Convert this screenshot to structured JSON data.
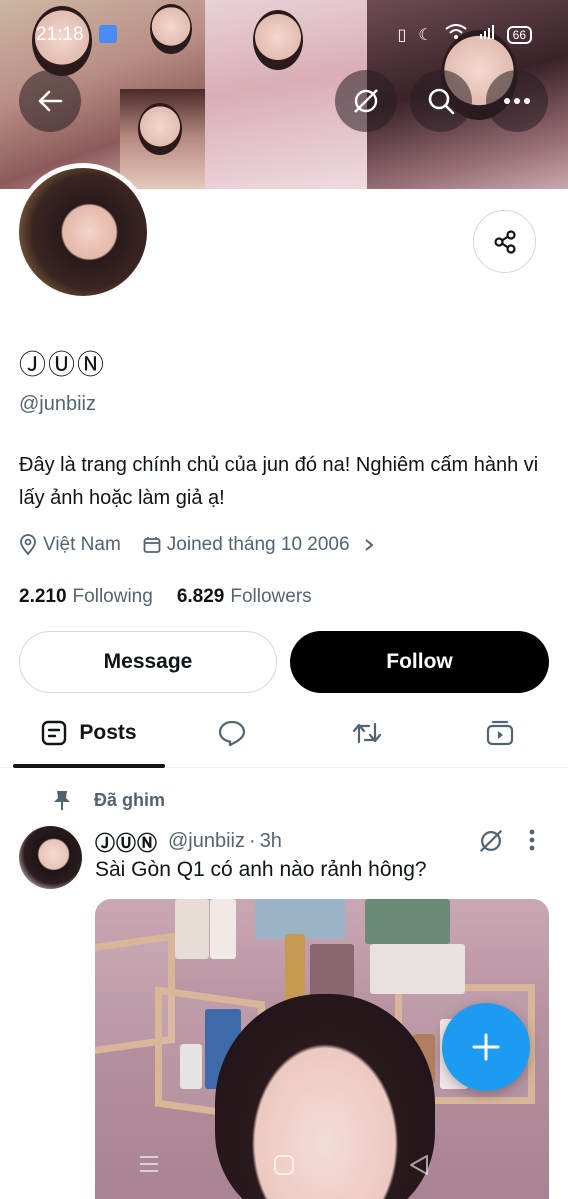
{
  "status_bar": {
    "time": "21:18",
    "battery": "66"
  },
  "profile": {
    "display_name": "ⒿⓊⓃ",
    "handle": "@junbiiz",
    "bio": "Đây là trang chính chủ của jun đó na! Nghiêm cấm hành vi lấy ảnh hoặc làm giả ạ!",
    "location": "Việt Nam",
    "joined": "Joined tháng 10 2006",
    "following_count": "2.210",
    "following_label": "Following",
    "followers_count": "6.829",
    "followers_label": "Followers"
  },
  "actions": {
    "message_label": "Message",
    "follow_label": "Follow"
  },
  "tabs": {
    "posts_label": "Posts"
  },
  "pinned_post": {
    "pinned_label": "Đã ghim",
    "author_name": "ⒿⓊⓃ",
    "author_handle": "@junbiiz",
    "separator": "·",
    "time": "3h",
    "text": "Sài Gòn Q1 có anh nào rảnh hông?"
  },
  "colors": {
    "accent": "#1d9bf0",
    "follow_bg": "#000000",
    "muted_text": "#536471"
  },
  "icons": [
    "back-arrow-icon",
    "grok-icon",
    "search-icon",
    "more-icon",
    "share-icon",
    "location-icon",
    "calendar-icon",
    "chevron-right-icon",
    "posts-tab-icon",
    "replies-tab-icon",
    "repost-tab-icon",
    "media-tab-icon",
    "pin-icon",
    "plus-icon"
  ]
}
